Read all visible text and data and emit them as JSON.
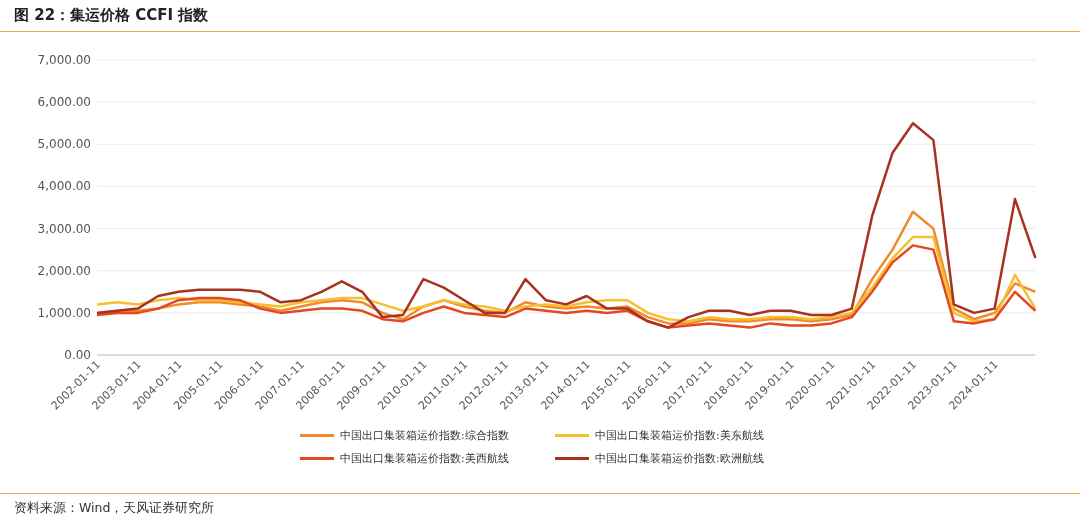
{
  "figure": {
    "title": "图 22：集运价格 CCFI 指数",
    "source": "资料来源：Wind，天风证券研究所",
    "chart_data": {
      "type": "line",
      "categories": [
        "2002-01-11",
        null,
        "2003-01-11",
        null,
        "2004-01-11",
        null,
        "2005-01-11",
        null,
        "2006-01-11",
        null,
        "2007-01-11",
        null,
        "2008-01-11",
        null,
        "2009-01-11",
        null,
        "2010-01-11",
        null,
        "2011-01-11",
        null,
        "2012-01-11",
        null,
        "2013-01-11",
        null,
        "2014-01-11",
        null,
        "2015-01-11",
        null,
        "2016-01-11",
        null,
        "2017-01-11",
        null,
        "2018-01-11",
        null,
        "2019-01-11",
        null,
        "2020-01-11",
        null,
        "2021-01-11",
        null,
        "2022-01-11",
        null,
        "2023-01-11",
        null,
        "2024-01-11",
        null,
        null
      ],
      "series": [
        {
          "name": "中国出口集装箱运价指数:综合指数",
          "color": "#f08a30",
          "values": [
            1000,
            1050,
            1050,
            1100,
            1200,
            1250,
            1250,
            1200,
            1150,
            1050,
            1150,
            1250,
            1300,
            1250,
            1000,
            850,
            1150,
            1300,
            1150,
            1050,
            1000,
            1250,
            1150,
            1100,
            1150,
            1100,
            1150,
            900,
            750,
            750,
            850,
            800,
            800,
            850,
            850,
            800,
            850,
            950,
            1800,
            2500,
            3400,
            3000,
            1100,
            850,
            1000,
            1700,
            1500
          ]
        },
        {
          "name": "中国出口集装箱运价指数:美东航线",
          "color": "#f7bf2e",
          "values": [
            1200,
            1250,
            1200,
            1300,
            1350,
            1300,
            1300,
            1250,
            1200,
            1150,
            1250,
            1300,
            1350,
            1350,
            1200,
            1050,
            1150,
            1300,
            1200,
            1150,
            1050,
            1150,
            1200,
            1150,
            1250,
            1300,
            1300,
            1000,
            850,
            800,
            900,
            850,
            850,
            900,
            900,
            850,
            900,
            1000,
            1600,
            2300,
            2800,
            2800,
            1000,
            800,
            850,
            1900,
            1100
          ]
        },
        {
          "name": "中国出口集装箱运价指数:美西航线",
          "color": "#e4481e",
          "values": [
            950,
            1000,
            1000,
            1100,
            1300,
            1350,
            1350,
            1300,
            1100,
            1000,
            1050,
            1100,
            1100,
            1050,
            850,
            800,
            1000,
            1150,
            1000,
            950,
            900,
            1100,
            1050,
            1000,
            1050,
            1000,
            1050,
            800,
            650,
            700,
            750,
            700,
            650,
            750,
            700,
            700,
            750,
            900,
            1500,
            2200,
            2600,
            2500,
            800,
            750,
            850,
            1500,
            1050
          ]
        },
        {
          "name": "中国出口集装箱运价指数:欧洲航线",
          "color": "#a8321f",
          "values": [
            1000,
            1050,
            1100,
            1400,
            1500,
            1550,
            1550,
            1550,
            1500,
            1250,
            1300,
            1500,
            1750,
            1500,
            900,
            950,
            1800,
            1600,
            1300,
            1000,
            1000,
            1800,
            1300,
            1200,
            1400,
            1100,
            1100,
            800,
            650,
            900,
            1050,
            1050,
            950,
            1050,
            1050,
            950,
            950,
            1100,
            3300,
            4800,
            5500,
            5100,
            1200,
            1000,
            1100,
            3700,
            2300
          ]
        }
      ],
      "ylim": [
        0,
        7000
      ],
      "grid": true,
      "yticks": [
        {
          "value": 0,
          "label": "0.00"
        },
        {
          "value": 1000,
          "label": "1,000.00"
        },
        {
          "value": 2000,
          "label": "2,000.00"
        },
        {
          "value": 3000,
          "label": "3,000.00"
        },
        {
          "value": 4000,
          "label": "4,000.00"
        },
        {
          "value": 5000,
          "label": "5,000.00"
        },
        {
          "value": 6000,
          "label": "6,000.00"
        },
        {
          "value": 7000,
          "label": "7,000.00"
        }
      ]
    }
  }
}
